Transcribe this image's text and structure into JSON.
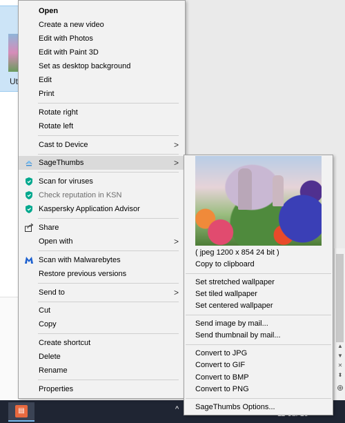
{
  "explorer": {
    "thumb_label": "Ut"
  },
  "menu": {
    "items": [
      {
        "label": "Open"
      },
      {
        "label": "Create a new video"
      },
      {
        "label": "Edit with Photos"
      },
      {
        "label": "Edit with Paint 3D"
      },
      {
        "label": "Set as desktop background"
      },
      {
        "label": "Edit"
      },
      {
        "label": "Print"
      },
      {
        "label": "Rotate right"
      },
      {
        "label": "Rotate left"
      },
      {
        "label": "Cast to Device"
      },
      {
        "label": "SageThumbs"
      },
      {
        "label": "Scan for viruses"
      },
      {
        "label": "Check reputation in KSN"
      },
      {
        "label": "Kaspersky Application Advisor"
      },
      {
        "label": "Share"
      },
      {
        "label": "Open with"
      },
      {
        "label": "Scan with Malwarebytes"
      },
      {
        "label": "Restore previous versions"
      },
      {
        "label": "Send to"
      },
      {
        "label": "Cut"
      },
      {
        "label": "Copy"
      },
      {
        "label": "Create shortcut"
      },
      {
        "label": "Delete"
      },
      {
        "label": "Rename"
      },
      {
        "label": "Properties"
      }
    ]
  },
  "submenu": {
    "image_info": "( jpeg 1200 x 854 24 bit )",
    "items": [
      {
        "label": "Copy to clipboard"
      },
      {
        "label": "Set stretched wallpaper"
      },
      {
        "label": "Set tiled wallpaper"
      },
      {
        "label": "Set centered wallpaper"
      },
      {
        "label": "Send image by mail..."
      },
      {
        "label": "Send thumbnail by mail..."
      },
      {
        "label": "Convert to JPG"
      },
      {
        "label": "Convert to GIF"
      },
      {
        "label": "Convert to BMP"
      },
      {
        "label": "Convert to PNG"
      },
      {
        "label": "SageThumbs Options..."
      }
    ]
  },
  "taskbar": {
    "date": "11-Jul-19",
    "tray_chevron": "^"
  },
  "icons": {
    "submenu_arrow": ">",
    "kaspersky_color": "#00a88e",
    "malwarebytes_color": "#1b5fcf",
    "sagethumbs_color": "#3b8fd6"
  }
}
